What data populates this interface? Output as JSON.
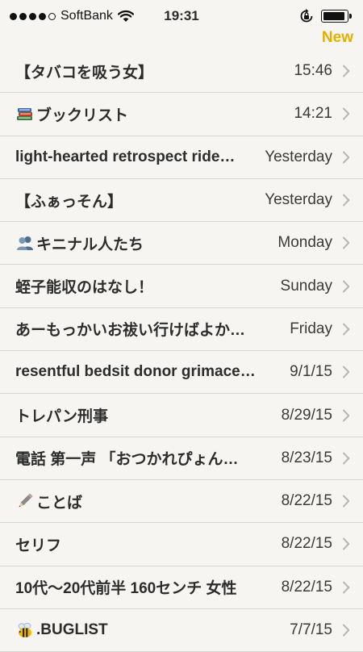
{
  "status_bar": {
    "carrier": "SoftBank",
    "time": "19:31",
    "signal_bars_filled": 4,
    "signal_bars_total": 5,
    "battery_level": 0.92,
    "icons": [
      "wifi-icon",
      "rotation-lock-icon",
      "battery-icon"
    ]
  },
  "nav": {
    "new_label": "New",
    "accent_color": "#e3b000"
  },
  "notes": [
    {
      "title": "【タバコを吸う女】",
      "date": "15:46",
      "icon": ""
    },
    {
      "title": "ブックリスト",
      "date": "14:21",
      "icon": "books-emoji"
    },
    {
      "title": "light-hearted retrospect ride…",
      "date": "Yesterday",
      "icon": ""
    },
    {
      "title": "【ふぁっそん】",
      "date": "Yesterday",
      "icon": ""
    },
    {
      "title": "キニナル人たち",
      "date": "Monday",
      "icon": "people-emoji"
    },
    {
      "title": "蛭子能収のはなし！",
      "date": "Sunday",
      "icon": ""
    },
    {
      "title": "あーもっかいお祓い行けばよか…",
      "date": "Friday",
      "icon": ""
    },
    {
      "title": "resentful bedsit donor grimace…",
      "date": "9/1/15",
      "icon": ""
    },
    {
      "title": "トレパン刑事",
      "date": "8/29/15",
      "icon": ""
    },
    {
      "title": "電話 第一声 「おつかれぴょん…",
      "date": "8/23/15",
      "icon": ""
    },
    {
      "title": "ことば",
      "date": "8/22/15",
      "icon": "pencil-emoji"
    },
    {
      "title": "セリフ",
      "date": "8/22/15",
      "icon": ""
    },
    {
      "title": "10代〜20代前半 160センチ 女性",
      "date": "8/22/15",
      "icon": ""
    },
    {
      "title": ".BUGLIST",
      "date": "7/7/15",
      "icon": "bee-emoji"
    }
  ]
}
